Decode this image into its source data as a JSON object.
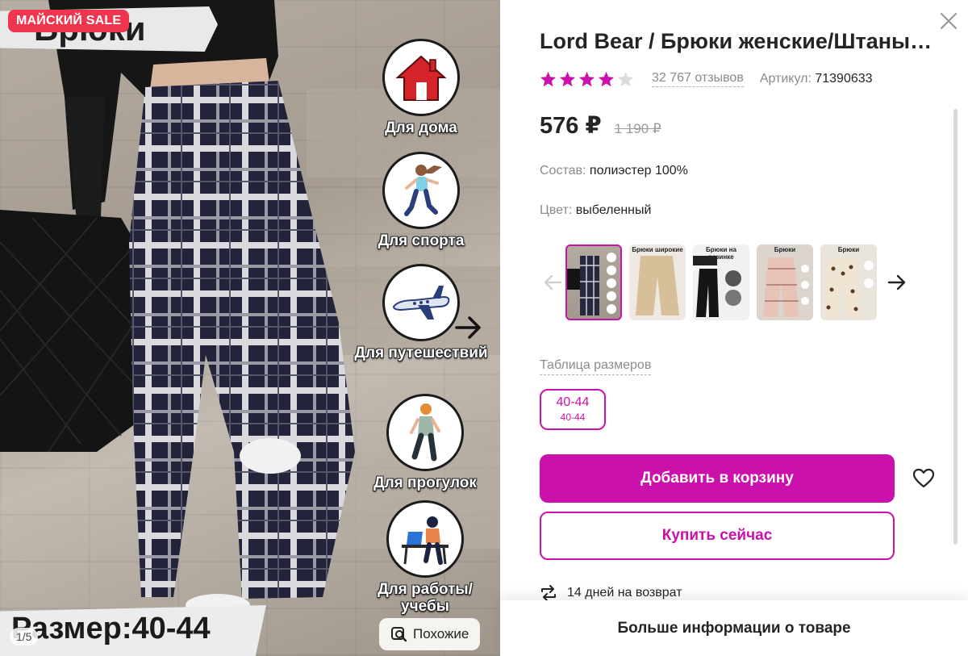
{
  "gallery": {
    "sale_badge": "МАЙСКИЙ SALE",
    "overlay_title": "Брюки",
    "size_banner": "Размер:40-44",
    "page_counter": "1/5",
    "similar_label": "Похожие",
    "features": [
      {
        "label": "Для дома",
        "icon": "house-icon"
      },
      {
        "label": "Для спорта",
        "icon": "runner-icon"
      },
      {
        "label": "Для путешествий",
        "icon": "airplane-icon"
      },
      {
        "label": "Для прогулок",
        "icon": "walker-icon"
      },
      {
        "label": "Для работы/учебы",
        "icon": "laptop-desk-icon"
      }
    ]
  },
  "product": {
    "title": "Lord Bear / Брюки женские/Штаны спортивные клетчатые",
    "rating_stars": 4,
    "rating_max": 5,
    "reviews": "32 767 отзывов",
    "article_label": "Артикул:",
    "article_value": "71390633",
    "price": "576 ₽",
    "old_price": "1 190 ₽",
    "composition_label": "Состав:",
    "composition_value": "полиэстер 100%",
    "color_label": "Цвет:",
    "color_value": "выбеленный",
    "size_table_link": "Таблица размеров",
    "size_option_main": "40-44",
    "size_option_sub": "40-44",
    "add_to_cart": "Добавить в корзину",
    "buy_now": "Купить сейчас",
    "returns": "14 дней на возврат",
    "more_info": "Больше информации о товаре"
  },
  "thumbnails": [
    {
      "title": "",
      "active": true
    },
    {
      "title": "Брюки широкие",
      "active": false
    },
    {
      "title": "Брюки на резинке",
      "active": false
    },
    {
      "title": "Брюки",
      "active": false
    },
    {
      "title": "Брюки",
      "active": false
    }
  ],
  "colors": {
    "accent": "#cb11ab",
    "sale": "#f0364f",
    "text": "#242424",
    "muted": "#8b8b8b",
    "star": "#cb11ab"
  }
}
